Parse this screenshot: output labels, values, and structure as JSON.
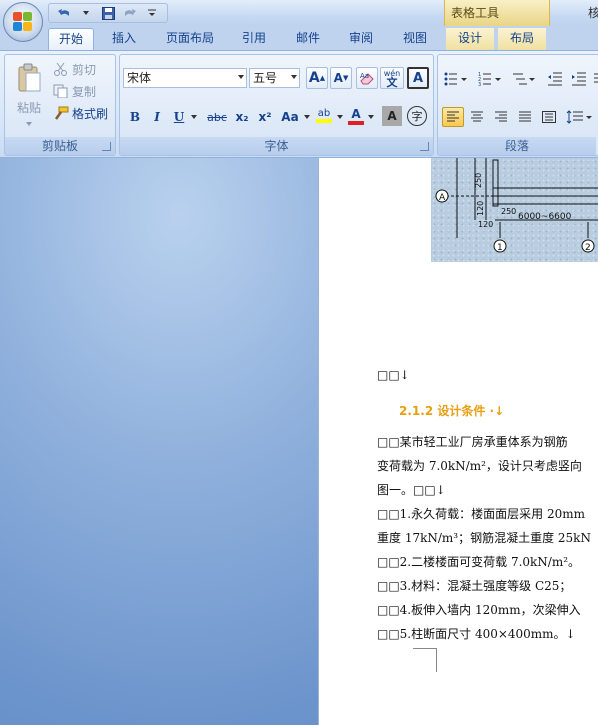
{
  "title_bar": {
    "context_tab_group": "表格工具",
    "title_partial": "核"
  },
  "tabs": [
    {
      "label": "开始",
      "active": true
    },
    {
      "label": "插入"
    },
    {
      "label": "页面布局"
    },
    {
      "label": "引用"
    },
    {
      "label": "邮件"
    },
    {
      "label": "审阅"
    },
    {
      "label": "视图"
    },
    {
      "label": "设计",
      "context": true
    },
    {
      "label": "布局",
      "context": true
    }
  ],
  "clipboard": {
    "label": "剪贴板",
    "paste": "粘贴",
    "cut": "剪切",
    "copy": "复制",
    "format_painter": "格式刷"
  },
  "font": {
    "label": "字体",
    "font_name": "宋体",
    "font_size": "五号",
    "grow": "A",
    "shrink": "A",
    "phonetic": "wén",
    "border_char": "A",
    "bold": "B",
    "italic": "I",
    "underline": "U",
    "strike": "abc",
    "subscript": "x₂",
    "superscript": "x²",
    "change_case": "Aa",
    "highlight": "ab",
    "font_color": "A",
    "shading": "A",
    "enclose": "字"
  },
  "paragraph": {
    "label": "段落"
  },
  "drawing": {
    "axis_a": "A",
    "dim_250_top": "250",
    "dim_120_a": "120",
    "dim_120_b": "120",
    "dim_250_mid": "250",
    "span": "6000~6600",
    "axis_1": "1",
    "axis_2": "2"
  },
  "document": {
    "line1": "□□↓",
    "heading": "2.1.2 设计条件 ·↓",
    "p1": "□□某市轻工业厂房承重体系为钢筋",
    "p2": "变荷载为 7.0kN/m²，设计只考虑竖向",
    "p3": "图一。□□↓",
    "p4": "□□1.永久荷载：楼面面层采用 20mm",
    "p5": "重度 17kN/m³；钢筋混凝土重度 25kN",
    "p6": "□□2.二楼楼面可变荷载 7.0kN/m²。",
    "p7": "□□3.材料：混凝土强度等级 C25；",
    "p8": "□□4.板伸入墙内 120mm，次梁伸入",
    "p9": "□□5.柱断面尺寸 400×400mm。↓"
  },
  "colors": {
    "heading": "#e8a013",
    "accent": "#15428b"
  }
}
